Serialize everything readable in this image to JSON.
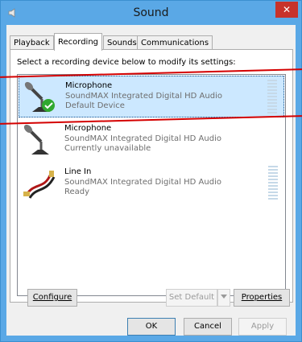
{
  "window": {
    "title": "Sound",
    "close_glyph": "✕"
  },
  "tabs": [
    {
      "label": "Playback"
    },
    {
      "label": "Recording"
    },
    {
      "label": "Sounds"
    },
    {
      "label": "Communications"
    }
  ],
  "active_tab": "Recording",
  "instruction": "Select a recording device below to modify its settings:",
  "devices": [
    {
      "name": "Microphone",
      "description": "SoundMAX Integrated Digital HD Audio",
      "status": "Default Device",
      "icon": "microphone-icon",
      "selected": true,
      "default_check": true
    },
    {
      "name": "Microphone",
      "description": "SoundMAX Integrated Digital HD Audio",
      "status": "Currently unavailable",
      "icon": "microphone-icon",
      "selected": false
    },
    {
      "name": "Line In",
      "description": "SoundMAX Integrated Digital HD Audio",
      "status": "Ready",
      "icon": "line-in-cable-icon",
      "selected": false
    }
  ],
  "buttons": {
    "configure": "Configure",
    "set_default": "Set Default",
    "properties": "Properties",
    "ok": "OK",
    "cancel": "Cancel",
    "apply": "Apply"
  },
  "colors": {
    "titlebar": "#5aa8e6",
    "close": "#c7322b",
    "selection": "#cce8ff",
    "annotation_line": "#d40000"
  }
}
